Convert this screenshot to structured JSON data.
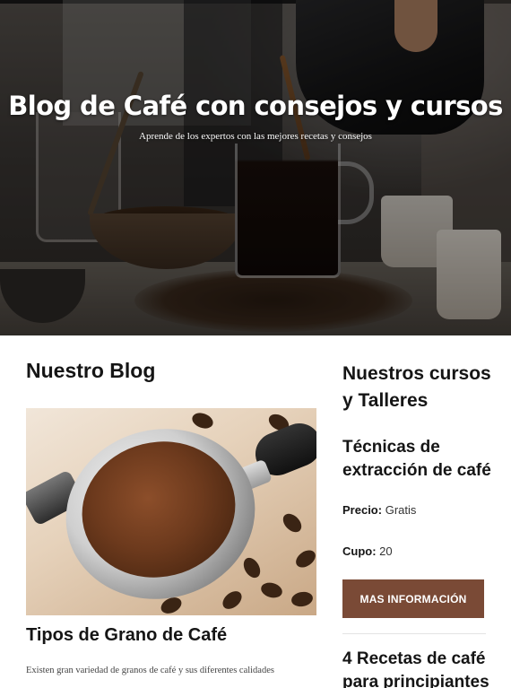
{
  "hero": {
    "title": "Blog de Café con consejos y cursos",
    "subtitle": "Aprende de los expertos con las mejores recetas y consejos"
  },
  "blog": {
    "heading": "Nuestro Blog",
    "posts": [
      {
        "title": "Tipos de Grano de Café",
        "excerpt": "Existen gran variedad de granos de café y sus diferentes calidades"
      }
    ]
  },
  "sidebar": {
    "heading": "Nuestros cursos y Talleres",
    "courses": [
      {
        "title": "Técnicas de extracción de café",
        "price_label": "Precio:",
        "price_value": "Gratis",
        "seats_label": "Cupo:",
        "seats_value": "20",
        "button_label": "Mas información"
      },
      {
        "title": "4 Recetas de café para principiantes"
      }
    ]
  },
  "colors": {
    "accent_button": "#7a4a36",
    "heading_text": "#151515"
  }
}
